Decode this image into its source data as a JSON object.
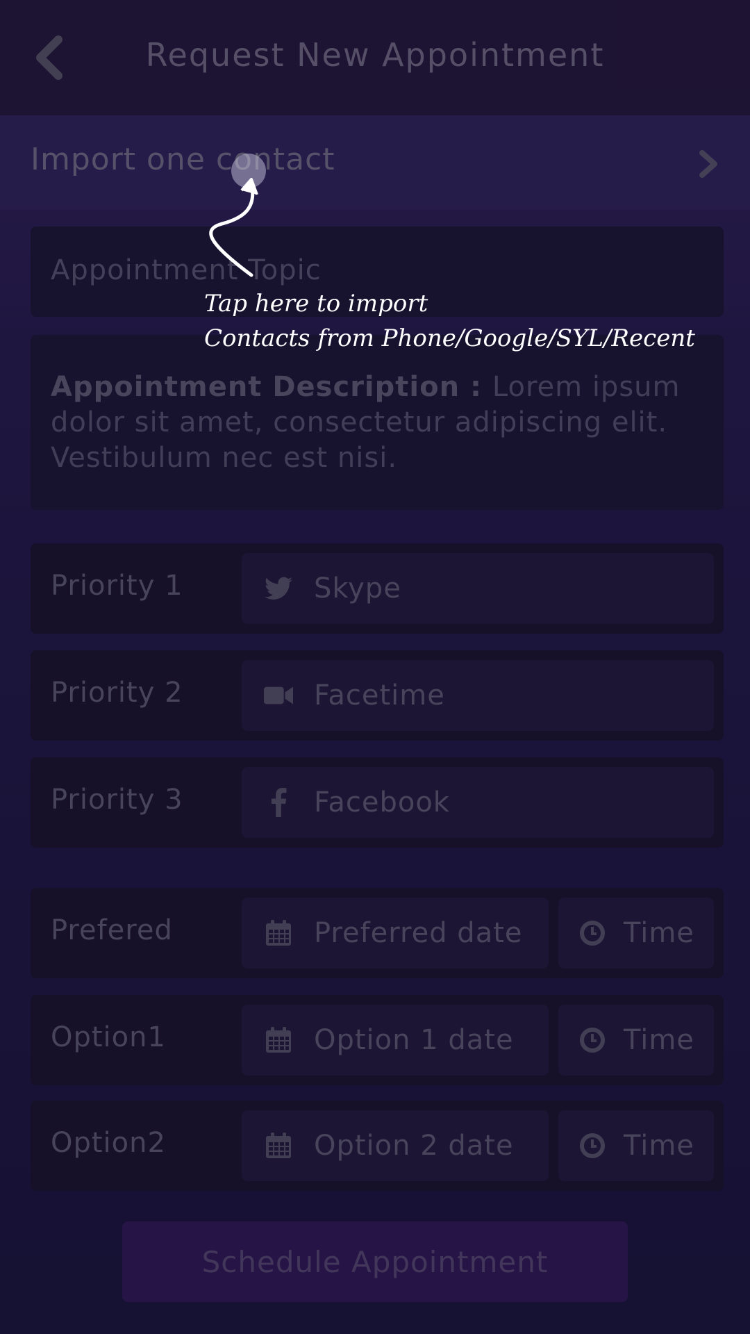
{
  "header": {
    "title": "Request New Appointment",
    "back_icon": "chevron-left-icon"
  },
  "import": {
    "label": "Import one contact",
    "chevron_icon": "chevron-right-icon"
  },
  "form": {
    "topic_placeholder": "Appointment Topic",
    "description_label": "Appointment Description : ",
    "description_text": "Lorem ipsum dolor sit amet, consectetur adipiscing elit. Vestibulum nec est nisi."
  },
  "priorities": [
    {
      "label": "Priority 1",
      "icon": "twitter-icon",
      "value": "Skype"
    },
    {
      "label": "Priority 2",
      "icon": "video-camera-icon",
      "value": "Facetime"
    },
    {
      "label": "Priority 3",
      "icon": "facebook-icon",
      "value": "Facebook"
    }
  ],
  "schedule_options": [
    {
      "label": "Prefered",
      "date_placeholder": "Preferred date",
      "time_placeholder": "Time"
    },
    {
      "label": "Option1",
      "date_placeholder": "Option 1 date",
      "time_placeholder": "Time"
    },
    {
      "label": "Option2",
      "date_placeholder": "Option 2 date",
      "time_placeholder": "Time"
    }
  ],
  "submit": {
    "label": "Schedule Appointment"
  },
  "hint": {
    "line1": "Tap here to import",
    "line2": "Contacts from Phone/Google/SYL/Recent"
  },
  "colors": {
    "background": "#2a1e58",
    "header": "#2c1d48",
    "button": "#3d1e6a",
    "hint_text": "#ffffff"
  }
}
